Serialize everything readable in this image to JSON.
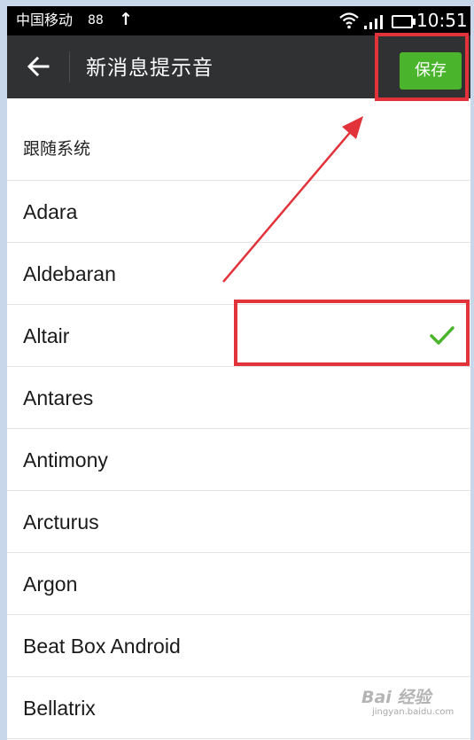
{
  "status_bar": {
    "carrier": "中国移动",
    "network": "88",
    "upload": "↑",
    "time": "10:51"
  },
  "header": {
    "back": "←",
    "title": "新消息提示音",
    "save_label": "保存"
  },
  "list": {
    "section_label": "跟随系统",
    "items": [
      {
        "label": "Adara",
        "selected": false
      },
      {
        "label": "Aldebaran",
        "selected": false
      },
      {
        "label": "Altair",
        "selected": true
      },
      {
        "label": "Antares",
        "selected": false
      },
      {
        "label": "Antimony",
        "selected": false
      },
      {
        "label": "Arcturus",
        "selected": false
      },
      {
        "label": "Argon",
        "selected": false
      },
      {
        "label": "Beat Box Android",
        "selected": false
      },
      {
        "label": "Bellatrix",
        "selected": false
      }
    ]
  },
  "colors": {
    "accent_green": "#4ab52c",
    "action_bar": "#2f3133",
    "annotation_red": "#e2333a"
  },
  "icons": {
    "back": "arrow-left-icon",
    "check": "check-icon",
    "wifi": "wifi-icon",
    "signal": "signal-icon",
    "battery": "battery-icon"
  },
  "watermark": {
    "main": "Bai 经验",
    "sub": "jingyan.baidu.com"
  }
}
